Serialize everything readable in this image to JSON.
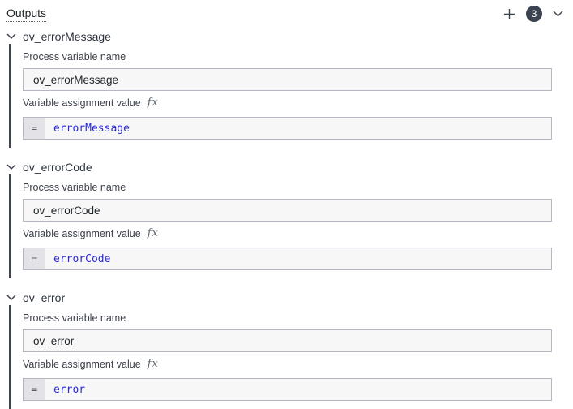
{
  "header": {
    "title": "Outputs",
    "count_badge": "3"
  },
  "labels": {
    "process_variable_name": "Process variable name",
    "variable_assignment_value": "Variable assignment value",
    "fx": "fx",
    "equals": "="
  },
  "colors": {
    "accent_dark": "#3d4451",
    "field_bg": "#f7f7f8",
    "field_border": "#b5b8c2",
    "prefix_bg": "#e3e3e7",
    "expression_text": "#2929d6"
  },
  "outputs": [
    {
      "name": "ov_errorMessage",
      "process_variable_name": "ov_errorMessage",
      "assignment_value": "errorMessage"
    },
    {
      "name": "ov_errorCode",
      "process_variable_name": "ov_errorCode",
      "assignment_value": "errorCode"
    },
    {
      "name": "ov_error",
      "process_variable_name": "ov_error",
      "assignment_value": "error"
    }
  ]
}
